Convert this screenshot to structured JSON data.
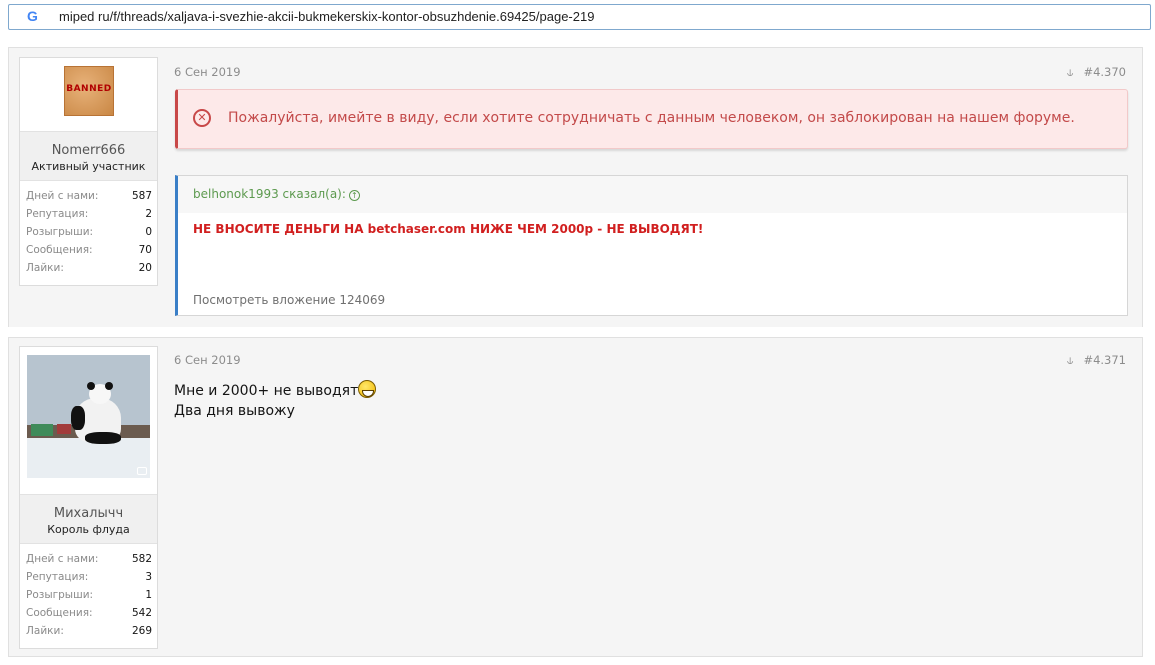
{
  "browser": {
    "url": "miped ru/f/threads/xaljava-i-svezhie-akcii-bukmekerskix-kontor-obsuzhdenie.69425/page-219",
    "icon": "google-g-icon"
  },
  "posts": [
    {
      "user": {
        "name": "Nomerr666",
        "title": "Активный участник",
        "avatar_label": "BANNED",
        "stats": [
          {
            "label": "Дней с нами:",
            "value": "587"
          },
          {
            "label": "Репутация:",
            "value": "2"
          },
          {
            "label": "Розыгрыши:",
            "value": "0"
          },
          {
            "label": "Сообщения:",
            "value": "70"
          },
          {
            "label": "Лайки:",
            "value": "20"
          }
        ]
      },
      "date": "6 Сен 2019",
      "number": "#4.370",
      "notice": "Пожалуйста, имейте в виду, если хотите сотрудничать с данным человеком, он заблокирован на нашем форуме.",
      "quote": {
        "author": "belhonok1993 сказал(а):",
        "text": "НЕ ВНОСИТЕ ДЕНЬГИ НА betchaser.com НИЖЕ ЧЕМ 2000р - НЕ ВЫВОДЯТ!",
        "attachment": "Посмотреть вложение 124069"
      }
    },
    {
      "user": {
        "name": "Михалычч",
        "title": "Король флуда",
        "stats": [
          {
            "label": "Дней с нами:",
            "value": "582"
          },
          {
            "label": "Репутация:",
            "value": "3"
          },
          {
            "label": "Розыгрыши:",
            "value": "1"
          },
          {
            "label": "Сообщения:",
            "value": "542"
          },
          {
            "label": "Лайки:",
            "value": "269"
          }
        ]
      },
      "date": "6 Сен 2019",
      "number": "#4.371",
      "body_line1": "Мне и 2000+ не выводят",
      "body_line2": "Два дня вывожу"
    }
  ],
  "colors": {
    "notice_text": "#c34a4a",
    "quote_text": "#d11f1f",
    "quote_author": "#5d9a4f",
    "quote_border": "#3a7fc7"
  }
}
